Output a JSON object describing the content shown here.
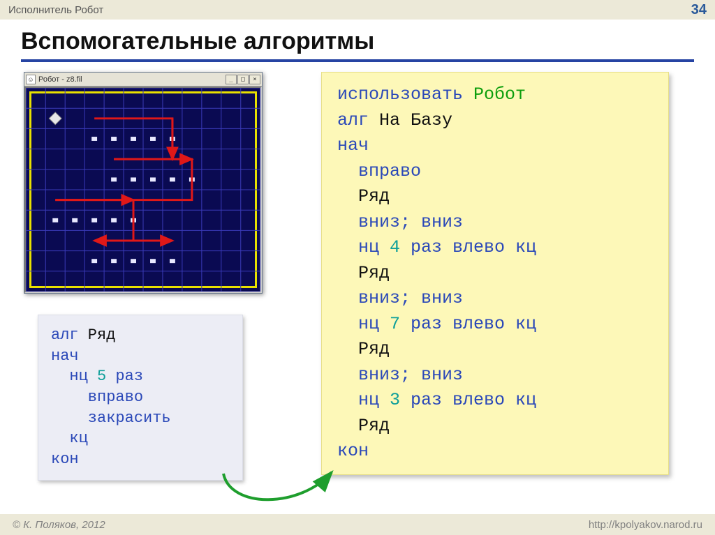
{
  "header": {
    "breadcrumb": "Исполнитель Робот",
    "page_number": "34"
  },
  "title": "Вспомогательные алгоритмы",
  "robot_window": {
    "title": "Робот - z8.fil",
    "grid": {
      "cols": 12,
      "rows": 10
    },
    "robot_cell": [
      2,
      2
    ],
    "painted_rows": [
      {
        "row": 3,
        "start": 4,
        "end": 8
      },
      {
        "row": 5,
        "start": 5,
        "end": 9
      },
      {
        "row": 7,
        "start": 2,
        "end": 6
      },
      {
        "row": 9,
        "start": 4,
        "end": 8
      }
    ],
    "red_path": [
      [
        4,
        2
      ],
      [
        8,
        2
      ],
      [
        8,
        4
      ],
      [
        5,
        4
      ],
      [
        9,
        4
      ],
      [
        9,
        6
      ],
      [
        2,
        6
      ],
      [
        6,
        6
      ],
      [
        6,
        8
      ],
      [
        4,
        8
      ],
      [
        8,
        8
      ]
    ]
  },
  "small_code": {
    "lines": [
      [
        {
          "t": "алг",
          "c": "blue"
        },
        {
          "t": " Ряд",
          "c": "black"
        }
      ],
      [
        {
          "t": "нач",
          "c": "blue"
        }
      ],
      [
        {
          "t": "  нц ",
          "c": "blue"
        },
        {
          "t": "5",
          "c": "teal"
        },
        {
          "t": " раз",
          "c": "blue"
        }
      ],
      [
        {
          "t": "    вправо",
          "c": "blue"
        }
      ],
      [
        {
          "t": "    закрасить",
          "c": "blue"
        }
      ],
      [
        {
          "t": "  кц",
          "c": "blue"
        }
      ],
      [
        {
          "t": "кон",
          "c": "blue"
        }
      ]
    ]
  },
  "big_code": {
    "lines": [
      [
        {
          "t": "использовать ",
          "c": "blue"
        },
        {
          "t": "Робот",
          "c": "green"
        }
      ],
      [
        {
          "t": "алг ",
          "c": "blue"
        },
        {
          "t": "На Базу",
          "c": "black"
        }
      ],
      [
        {
          "t": "нач",
          "c": "blue"
        }
      ],
      [
        {
          "t": "  вправо",
          "c": "blue"
        }
      ],
      [
        {
          "t": "  Ряд",
          "c": "black"
        }
      ],
      [
        {
          "t": "  вниз; вниз",
          "c": "blue"
        }
      ],
      [
        {
          "t": "  нц ",
          "c": "blue"
        },
        {
          "t": "4",
          "c": "teal"
        },
        {
          "t": " раз влево кц",
          "c": "blue"
        }
      ],
      [
        {
          "t": "  Ряд",
          "c": "black"
        }
      ],
      [
        {
          "t": "  вниз; вниз",
          "c": "blue"
        }
      ],
      [
        {
          "t": "  нц ",
          "c": "blue"
        },
        {
          "t": "7",
          "c": "teal"
        },
        {
          "t": " раз влево кц",
          "c": "blue"
        }
      ],
      [
        {
          "t": "  Ряд",
          "c": "black"
        }
      ],
      [
        {
          "t": "  вниз; вниз",
          "c": "blue"
        }
      ],
      [
        {
          "t": "  нц ",
          "c": "blue"
        },
        {
          "t": "3",
          "c": "teal"
        },
        {
          "t": " раз влево кц",
          "c": "blue"
        }
      ],
      [
        {
          "t": "  Ряд",
          "c": "black"
        }
      ],
      [
        {
          "t": "кон",
          "c": "blue"
        }
      ]
    ]
  },
  "footer": {
    "copyright": "© К. Поляков, 2012",
    "url": "http://kpolyakov.narod.ru"
  }
}
